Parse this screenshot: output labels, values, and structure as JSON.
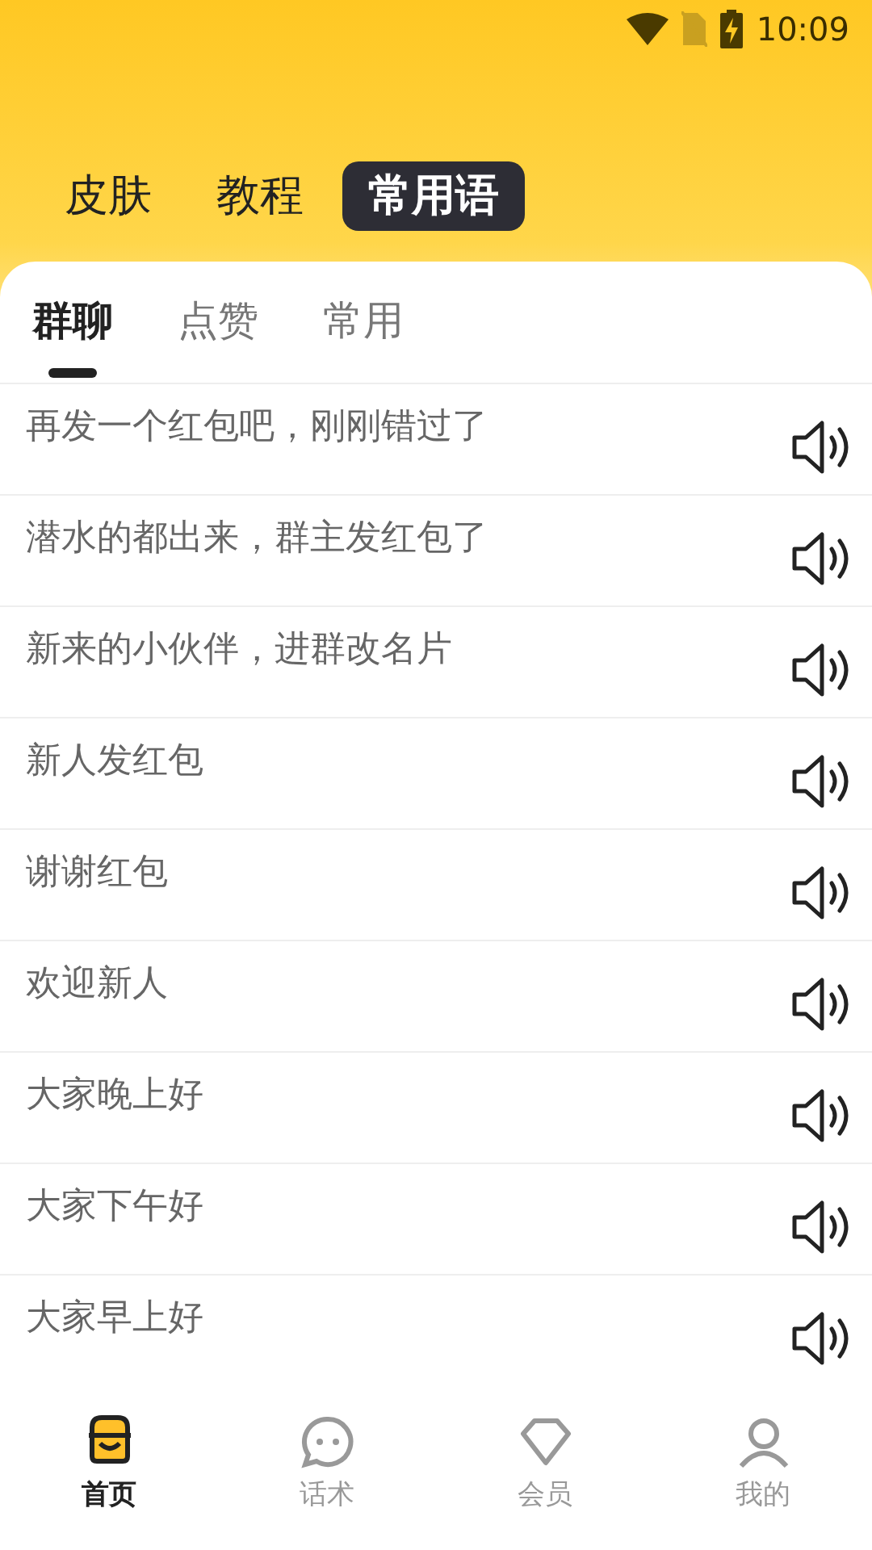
{
  "status_bar": {
    "time": "10:09"
  },
  "top_tabs": [
    {
      "label": "皮肤",
      "selected": false
    },
    {
      "label": "教程",
      "selected": false
    },
    {
      "label": "常用语",
      "selected": true
    }
  ],
  "sub_tabs": [
    {
      "label": "群聊",
      "selected": true
    },
    {
      "label": "点赞",
      "selected": false
    },
    {
      "label": "常用",
      "selected": false
    }
  ],
  "phrases": [
    "再发一个红包吧，刚刚错过了",
    "潜水的都出来，群主发红包了",
    "新来的小伙伴，进群改名片",
    "新人发红包",
    "谢谢红包",
    "欢迎新人",
    "大家晚上好",
    "大家下午好",
    "大家早上好"
  ],
  "bottom_nav": [
    {
      "label": "首页",
      "kind": "home",
      "selected": true
    },
    {
      "label": "话术",
      "kind": "chat",
      "selected": false
    },
    {
      "label": "会员",
      "kind": "vip",
      "selected": false
    },
    {
      "label": "我的",
      "kind": "me",
      "selected": false
    }
  ]
}
